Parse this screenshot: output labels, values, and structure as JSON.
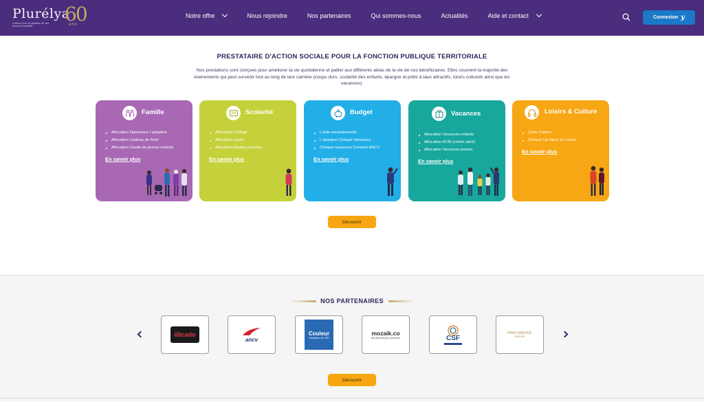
{
  "header": {
    "logo_name": "Plurélya",
    "logo_tagline": "Culture pour la gestion de vos œuvres sociales",
    "anniversary": "60",
    "anniversary_sub": "ANS",
    "nav": [
      {
        "label": "Notre offre",
        "dropdown": true
      },
      {
        "label": "Nous rejoindre",
        "dropdown": false
      },
      {
        "label": "Nos partenaires",
        "dropdown": false
      },
      {
        "label": "Qui sommes-nous",
        "dropdown": false
      },
      {
        "label": "Actualités",
        "dropdown": false
      },
      {
        "label": "Aide et contact",
        "dropdown": true
      }
    ],
    "search_icon": "search-icon",
    "connexion_label": "Connexion",
    "connexion_glyph": "y",
    "bg_color": "#4a2d7d",
    "button_color": "#1b79c7"
  },
  "main": {
    "title": "PRESTATAIRE D'ACTION SOCIALE POUR LA FONCTION PUBLIQUE TERRITORIALE",
    "intro": "Nos prestations sont conçues pour améliorer la vie quotidienne et pallier aux différents aléas de la vie de nos bénéficiaires. Elles couvrent la majorité des évènements qui peut survenir tout au long de leur carrière (coups durs, scolarité des enfants, épargne et prêts à taux attractifs, loisirs culturels ainsi que les vacances).",
    "cards": [
      {
        "title": "Famille",
        "icon": "family-icon",
        "color": "#a868b4",
        "items": [
          "Allocation Naissance / adoption",
          "Allocation Cadeau de Noël",
          "Allocation Garde de jeunes enfants"
        ],
        "link": "En savoir plus"
      },
      {
        "title": "Scolarité",
        "icon": "school-board-icon",
        "color": "#c5d13a",
        "items": [
          "Allocation Collège",
          "Allocation Lycée",
          "Allocation Études post-bac"
        ],
        "link": "En savoir plus"
      },
      {
        "title": "Budget",
        "icon": "piggy-bank-icon",
        "color": "#22aee6",
        "items": [
          "L'aide exceptionnelle",
          "L'épargne Chèque-Vacances",
          "Chèque-vacances Connect ANCV"
        ],
        "link": "En savoir plus"
      },
      {
        "title": "Vacances",
        "icon": "suitcase-icon",
        "color": "#17a79c",
        "items": [
          "Allocation Vacances enfants",
          "Allocation ACM (centre aéré)",
          "Allocation Vacances jeunes"
        ],
        "link": "En savoir plus"
      },
      {
        "title": "Loisirs & Culture",
        "icon": "headphones-icon",
        "color": "#f7a614",
        "items": [
          "Carte Culture",
          "Chèque Up Sport et Loisirs"
        ],
        "link": "En savoir plus"
      }
    ],
    "discover_label": "Découvrir"
  },
  "partners": {
    "title": "NOS PARTENAIRES",
    "logos": [
      {
        "name": "illicado",
        "text": "illicado"
      },
      {
        "name": "ancv",
        "text": "ancv"
      },
      {
        "name": "couleur-csr",
        "text": "Couleur",
        "sub": "Animateur de CSR"
      },
      {
        "name": "mozaik",
        "text": "mozaik.co",
        "sub": "Ma bibliothèque numérique"
      },
      {
        "name": "csf",
        "text": "CSF"
      },
      {
        "name": "parfumerie",
        "text": "PARFUMERIE",
        "sub": "EUROPE"
      }
    ],
    "prev_icon": "chevron-left-icon",
    "next_icon": "chevron-right-icon",
    "discover_label": "Découvrir"
  }
}
